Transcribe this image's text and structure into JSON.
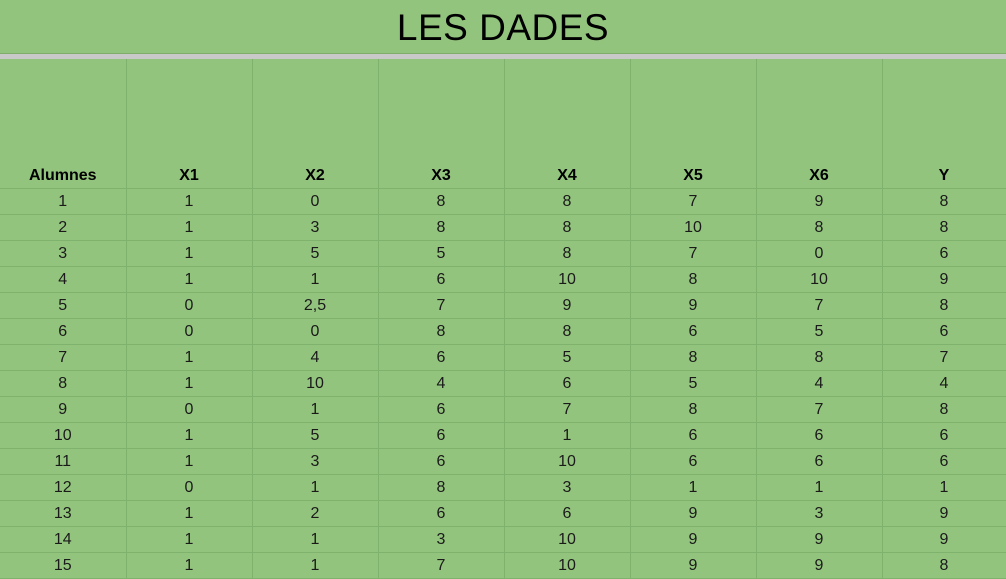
{
  "title": "LES DADES",
  "headers": [
    "Alumnes",
    "X1",
    "X2",
    "X3",
    "X4",
    "X5",
    "X6",
    "Y"
  ],
  "rows": [
    [
      "1",
      "1",
      "0",
      "8",
      "8",
      "7",
      "9",
      "8"
    ],
    [
      "2",
      "1",
      "3",
      "8",
      "8",
      "10",
      "8",
      "8"
    ],
    [
      "3",
      "1",
      "5",
      "5",
      "8",
      "7",
      "0",
      "6"
    ],
    [
      "4",
      "1",
      "1",
      "6",
      "10",
      "8",
      "10",
      "9"
    ],
    [
      "5",
      "0",
      "2,5",
      "7",
      "9",
      "9",
      "7",
      "8"
    ],
    [
      "6",
      "0",
      "0",
      "8",
      "8",
      "6",
      "5",
      "6"
    ],
    [
      "7",
      "1",
      "4",
      "6",
      "5",
      "8",
      "8",
      "7"
    ],
    [
      "8",
      "1",
      "10",
      "4",
      "6",
      "5",
      "4",
      "4"
    ],
    [
      "9",
      "0",
      "1",
      "6",
      "7",
      "8",
      "7",
      "8"
    ],
    [
      "10",
      "1",
      "5",
      "6",
      "1",
      "6",
      "6",
      "6"
    ],
    [
      "11",
      "1",
      "3",
      "6",
      "10",
      "6",
      "6",
      "6"
    ],
    [
      "12",
      "0",
      "1",
      "8",
      "3",
      "1",
      "1",
      "1"
    ],
    [
      "13",
      "1",
      "2",
      "6",
      "6",
      "9",
      "3",
      "9"
    ],
    [
      "14",
      "1",
      "1",
      "3",
      "10",
      "9",
      "9",
      "9"
    ],
    [
      "15",
      "1",
      "1",
      "7",
      "10",
      "9",
      "9",
      "8"
    ]
  ],
  "colors": {
    "background": "#93c47d",
    "gridline": "#7fb26c",
    "separator": "#c9c9c9"
  }
}
